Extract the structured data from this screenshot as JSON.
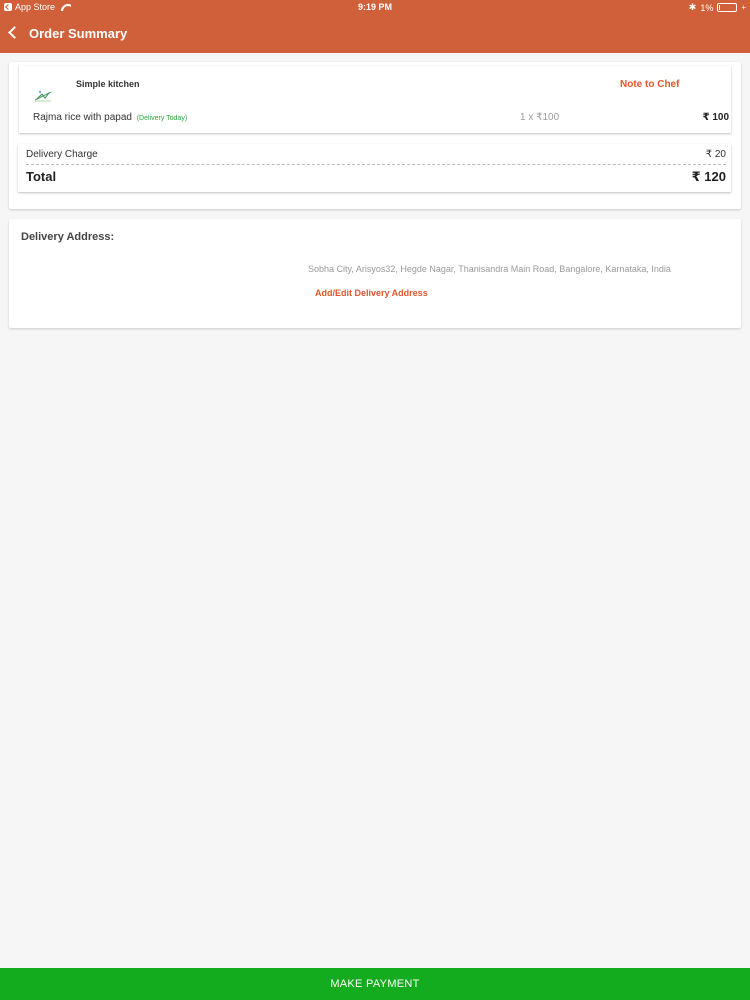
{
  "status_bar": {
    "carrier": "App Store",
    "time": "9:19 PM",
    "battery": "1%"
  },
  "header": {
    "title": "Order Summary",
    "back_icon": "chevron-left-icon"
  },
  "order": {
    "kitchen_name": "Simple kitchen",
    "note_label": "Note to Chef",
    "item": {
      "name": "Rajma rice with papad",
      "tag": "(Delivery Today)",
      "quantity": "1 x ₹100",
      "price": "₹ 100"
    },
    "delivery_charge_label": "Delivery Charge",
    "delivery_charge_value": "₹ 20",
    "total_label": "Total",
    "total_value": "₹ 120"
  },
  "address": {
    "heading": "Delivery Address:",
    "text": "Sobha City, Arisyos32, Hegde Nagar, Thanisandra Main Road, Bangalore, Karnataka, India",
    "edit_label": "Add/Edit Delivery Address"
  },
  "footer": {
    "button_label": "MAKE PAYMENT"
  },
  "colors": {
    "header": "#cf603a",
    "accent": "#e2562a",
    "delivery_tag": "#2ea53a",
    "payment_button": "#13ac1f"
  }
}
